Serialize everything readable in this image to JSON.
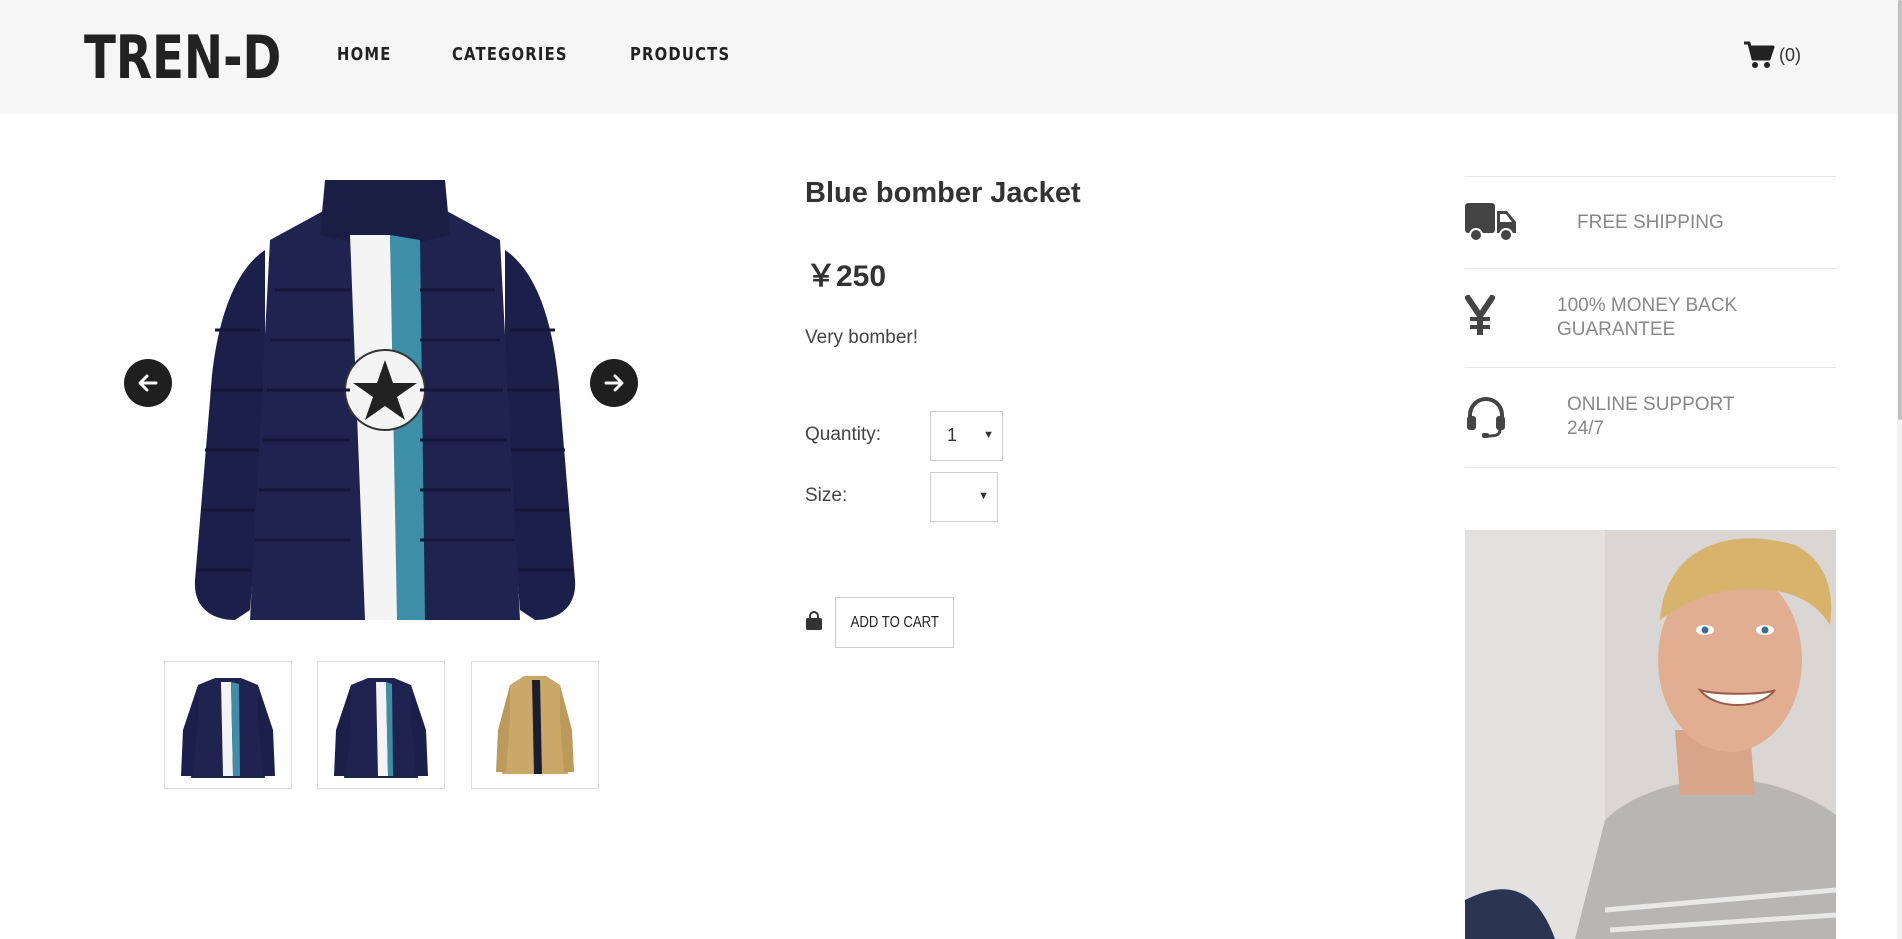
{
  "header": {
    "logo": "TREN-D",
    "nav": [
      "HOME",
      "CATEGORIES",
      "PRODUCTS"
    ],
    "cart_count": "(0)"
  },
  "gallery": {
    "prev_icon": "arrow-left-icon",
    "next_icon": "arrow-right-icon",
    "thumbnails": [
      "navy puffer jacket front",
      "navy puffer jacket side",
      "beige coat"
    ]
  },
  "product": {
    "title": "Blue bomber Jacket",
    "price": "￥250",
    "description": "Very bomber!",
    "quantity_label": "Quantity:",
    "quantity_value": "1",
    "size_label": "Size:",
    "size_value": "",
    "add_to_cart": "ADD TO CART"
  },
  "features": [
    {
      "icon": "truck-icon",
      "line1": "FREE SHIPPING",
      "line2": ""
    },
    {
      "icon": "yen-icon",
      "line1": "100% MONEY BACK",
      "line2": "GUARANTEE"
    },
    {
      "icon": "headset-icon",
      "line1": "ONLINE SUPPORT",
      "line2": "24/7"
    }
  ],
  "colors": {
    "header_bg": "#f6f6f6",
    "text_dark": "#333333",
    "feature_text": "#888888",
    "jacket_navy": "#1c1f4a",
    "coat_beige": "#c9a86a"
  }
}
